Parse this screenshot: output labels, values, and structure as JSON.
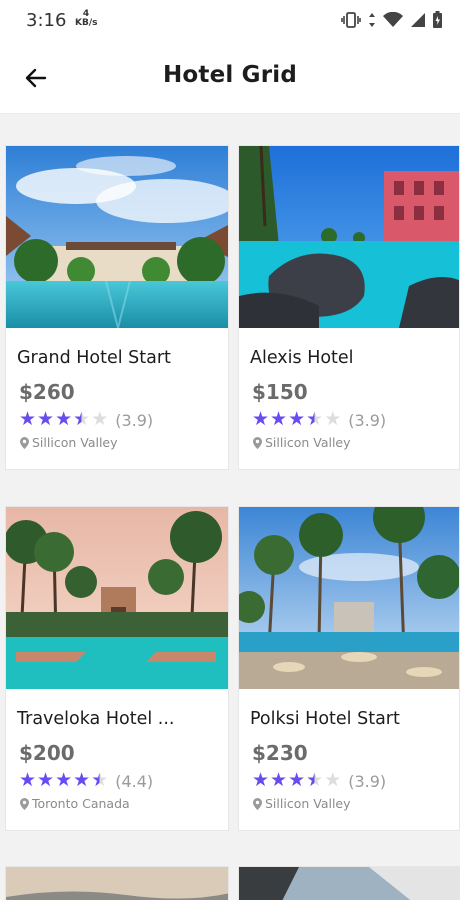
{
  "status_bar": {
    "time": "3:16",
    "speed_value": "4",
    "speed_unit": "KB/s",
    "icons": [
      "vibrate-icon",
      "data-arrows-icon",
      "wifi-icon",
      "signal-icon",
      "battery-icon"
    ]
  },
  "app_bar": {
    "title": "Hotel Grid",
    "back_icon": "back-arrow-icon"
  },
  "colors": {
    "star": "#6a4bf0",
    "star_empty": "#dddddd",
    "price": "#6b6b6b",
    "muted": "#8b8b8b"
  },
  "hotels": [
    {
      "name": "Grand Hotel Start",
      "price": "$260",
      "rating": 3.9,
      "rating_text": "(3.9)",
      "location": "Sillicon Valley"
    },
    {
      "name": "Alexis Hotel",
      "price": "$150",
      "rating": 3.9,
      "rating_text": "(3.9)",
      "location": "Sillicon Valley"
    },
    {
      "name": "Traveloka Hotel ...",
      "price": "$200",
      "rating": 4.4,
      "rating_text": "(4.4)",
      "location": "Toronto Canada"
    },
    {
      "name": "Polksi Hotel Start",
      "price": "$230",
      "rating": 3.9,
      "rating_text": "(3.9)",
      "location": "Sillicon Valley"
    }
  ]
}
